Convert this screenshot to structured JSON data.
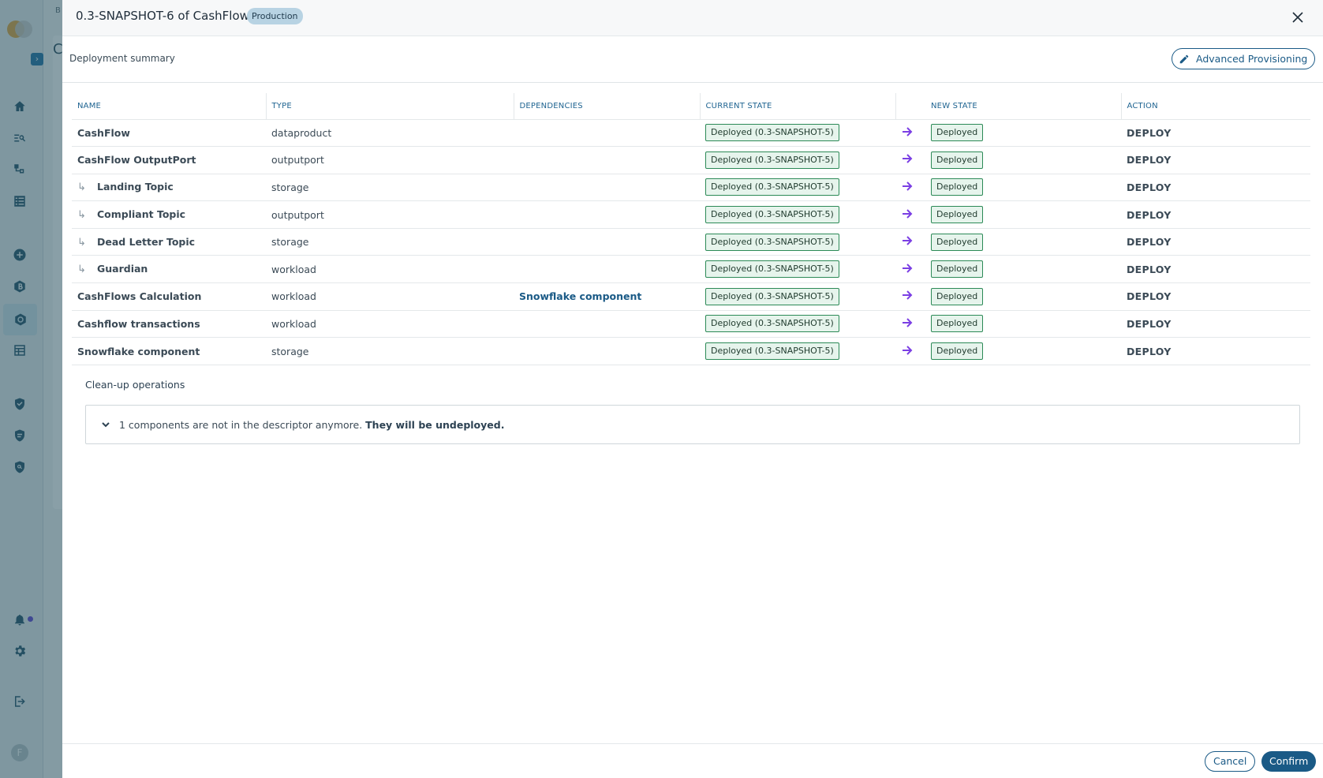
{
  "background": {
    "breadcrumb_fragment": "B",
    "heading_fragment": "C",
    "avatar_initial": "F"
  },
  "sidebar": {
    "icons": [
      "home-icon",
      "search-list-icon",
      "hierarchy-icon",
      "checklist-icon",
      "add-circle-icon",
      "b-badge-icon",
      "hexagon-icon",
      "table-icon",
      "shield-check-icon",
      "shield-list-icon",
      "shield-search-icon",
      "bell-icon",
      "gear-icon",
      "logout-icon"
    ],
    "active": "hexagon-icon"
  },
  "drawer": {
    "title": "0.3-SNAPSHOT-6 of CashFlow",
    "environment": "Production",
    "summary_title": "Deployment summary",
    "advanced_provisioning_label": "Advanced Provisioning",
    "columns": {
      "name": "NAME",
      "type": "TYPE",
      "dependencies": "DEPENDENCIES",
      "current_state": "CURRENT STATE",
      "new_state": "NEW STATE",
      "action": "ACTION"
    },
    "rows": [
      {
        "name": "CashFlow",
        "child": false,
        "type": "dataproduct",
        "dependency": "",
        "current_state": "Deployed (0.3-SNAPSHOT-5)",
        "new_state": "Deployed",
        "action": "DEPLOY"
      },
      {
        "name": "CashFlow OutputPort",
        "child": false,
        "type": "outputport",
        "dependency": "",
        "current_state": "Deployed (0.3-SNAPSHOT-5)",
        "new_state": "Deployed",
        "action": "DEPLOY"
      },
      {
        "name": "Landing Topic",
        "child": true,
        "type": "storage",
        "dependency": "",
        "current_state": "Deployed (0.3-SNAPSHOT-5)",
        "new_state": "Deployed",
        "action": "DEPLOY"
      },
      {
        "name": "Compliant Topic",
        "child": true,
        "type": "outputport",
        "dependency": "",
        "current_state": "Deployed (0.3-SNAPSHOT-5)",
        "new_state": "Deployed",
        "action": "DEPLOY"
      },
      {
        "name": "Dead Letter Topic",
        "child": true,
        "type": "storage",
        "dependency": "",
        "current_state": "Deployed (0.3-SNAPSHOT-5)",
        "new_state": "Deployed",
        "action": "DEPLOY"
      },
      {
        "name": "Guardian",
        "child": true,
        "type": "workload",
        "dependency": "",
        "current_state": "Deployed (0.3-SNAPSHOT-5)",
        "new_state": "Deployed",
        "action": "DEPLOY"
      },
      {
        "name": "CashFlows Calculation",
        "child": false,
        "type": "workload",
        "dependency": "Snowflake component",
        "current_state": "Deployed (0.3-SNAPSHOT-5)",
        "new_state": "Deployed",
        "action": "DEPLOY"
      },
      {
        "name": "Cashflow transactions",
        "child": false,
        "type": "workload",
        "dependency": "",
        "current_state": "Deployed (0.3-SNAPSHOT-5)",
        "new_state": "Deployed",
        "action": "DEPLOY"
      },
      {
        "name": "Snowflake component",
        "child": false,
        "type": "storage",
        "dependency": "",
        "current_state": "Deployed (0.3-SNAPSHOT-5)",
        "new_state": "Deployed",
        "action": "DEPLOY"
      }
    ],
    "cleanup_title": "Clean-up operations",
    "cleanup_message": "1 components are not in the descriptor anymore.",
    "cleanup_emphasis": "They will be undeployed.",
    "cancel_label": "Cancel",
    "confirm_label": "Confirm"
  },
  "colors": {
    "primary": "#1a5a86",
    "chip_border": "#2c8a57",
    "chip_fill": "#e6f4ec",
    "arrow": "#7b3fe4",
    "badge": "#b8d3e3"
  }
}
